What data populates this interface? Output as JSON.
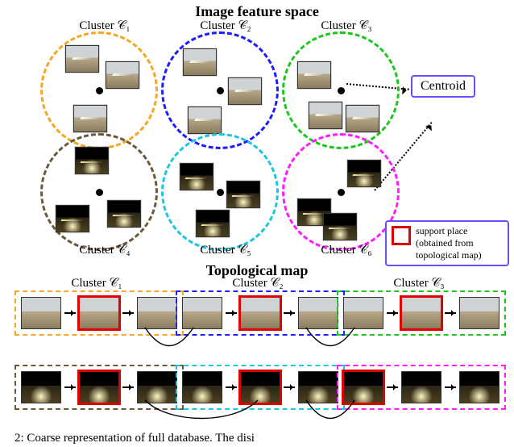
{
  "headings": {
    "feature_space": "Image feature space",
    "topological": "Topological map"
  },
  "clusters": {
    "c1": "Cluster 𝒞₁",
    "c2": "Cluster 𝒞₂",
    "c3": "Cluster 𝒞₃",
    "c4": "Cluster 𝒞₄",
    "c5": "Cluster 𝒞₅",
    "c6": "Cluster 𝒞₆"
  },
  "centroid_label": "Centroid",
  "legend_support": "support place (obtained from topological map)",
  "caption_fragment": "2: Coarse representation of full database. The disi",
  "colors": {
    "c1": "#f5a623",
    "c2": "#1c1cff",
    "c3": "#1cc61c",
    "c4": "#6b5a3a",
    "c5": "#1cc6e0",
    "c6": "#ff1cff"
  },
  "feature_space": {
    "c1": {
      "mode": "day",
      "thumbs": 3
    },
    "c2": {
      "mode": "day",
      "thumbs": 3
    },
    "c3": {
      "mode": "day",
      "thumbs": 3
    },
    "c4": {
      "mode": "night",
      "thumbs": 3
    },
    "c5": {
      "mode": "night",
      "thumbs": 3
    },
    "c6": {
      "mode": "night",
      "thumbs": 3
    }
  },
  "topological": {
    "c1": {
      "mode": "day",
      "thumbs": 3,
      "support_index": 1
    },
    "c2": {
      "mode": "day",
      "thumbs": 3,
      "support_index": 1
    },
    "c3": {
      "mode": "day",
      "thumbs": 3,
      "support_index": 1
    },
    "c4": {
      "mode": "night",
      "thumbs": 3,
      "support_index": 1
    },
    "c5": {
      "mode": "night",
      "thumbs": 3,
      "support_index": 1
    },
    "c6": {
      "mode": "night",
      "thumbs": 3,
      "support_index": 0
    }
  }
}
